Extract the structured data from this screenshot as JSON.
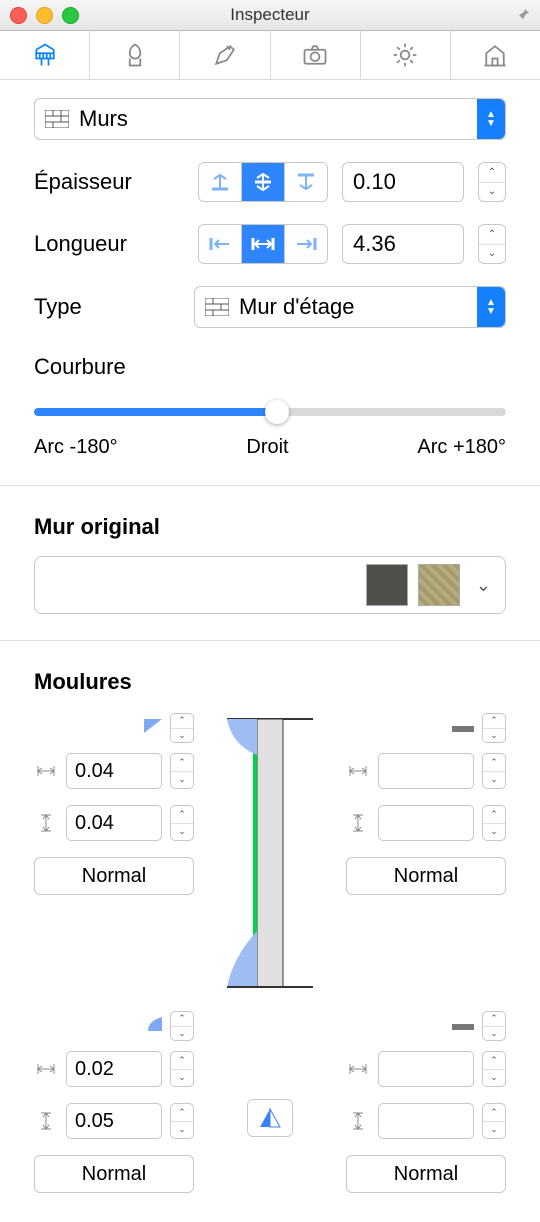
{
  "window": {
    "title": "Inspecteur"
  },
  "object_selector": {
    "label": "Murs"
  },
  "thickness": {
    "label": "Épaisseur",
    "value": "0.10"
  },
  "length": {
    "label": "Longueur",
    "value": "4.36"
  },
  "type": {
    "label": "Type",
    "value": "Mur d'étage"
  },
  "curvature": {
    "label": "Courbure",
    "min_label": "Arc -180°",
    "mid_label": "Droit",
    "max_label": "Arc +180°"
  },
  "original_wall": {
    "title": "Mur original",
    "swatch1": "#4e514b",
    "swatch2": "#b6ac7e"
  },
  "mouldings": {
    "title": "Moulures",
    "normal_label": "Normal",
    "top_left": {
      "width": "0.04",
      "height": "0.04"
    },
    "top_right": {
      "width": "",
      "height": ""
    },
    "bottom_left": {
      "width": "0.02",
      "height": "0.05"
    },
    "bottom_right": {
      "width": "",
      "height": ""
    }
  }
}
